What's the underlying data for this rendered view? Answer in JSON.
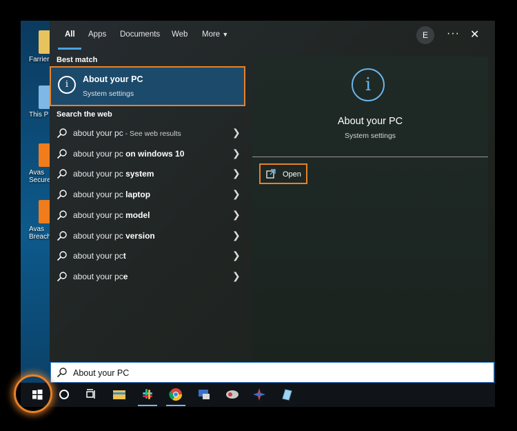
{
  "desktop": {
    "icons": [
      {
        "label": "Farrier P",
        "icon": "folder-icon"
      },
      {
        "label": "This P",
        "icon": "computer-icon"
      },
      {
        "label": "Avas\nSecure",
        "icon": "avast-secureline-icon"
      },
      {
        "label": "Avas\nBreachG",
        "icon": "avast-breachguard-icon"
      }
    ]
  },
  "tabs": {
    "items": [
      "All",
      "Apps",
      "Documents",
      "Web",
      "More"
    ],
    "active": "All",
    "avatar_letter": "E",
    "more_options": "···",
    "close": "✕"
  },
  "best_match": {
    "heading": "Best match",
    "title": "About your PC",
    "subtitle": "System settings",
    "icon": "info-icon"
  },
  "web": {
    "heading": "Search the web",
    "results": [
      {
        "prefix": "about your pc",
        "bold": "",
        "suffix": " - See web results"
      },
      {
        "prefix": "about your pc ",
        "bold": "on windows 10",
        "suffix": ""
      },
      {
        "prefix": "about your pc ",
        "bold": "system",
        "suffix": ""
      },
      {
        "prefix": "about your pc ",
        "bold": "laptop",
        "suffix": ""
      },
      {
        "prefix": "about your pc ",
        "bold": "model",
        "suffix": ""
      },
      {
        "prefix": "about your pc ",
        "bold": "version",
        "suffix": ""
      },
      {
        "prefix": "about your pc",
        "bold": "t",
        "suffix": ""
      },
      {
        "prefix": "about your pc",
        "bold": "e",
        "suffix": ""
      }
    ]
  },
  "detail": {
    "title": "About your PC",
    "subtitle": "System settings",
    "icon": "info-icon",
    "open_label": "Open"
  },
  "search": {
    "value": "About your PC"
  },
  "taskbar": {
    "items": [
      "windows-start-icon",
      "cortana-icon",
      "task-view-icon",
      "file-explorer-icon",
      "slack-icon",
      "chrome-icon",
      "network-app-icon",
      "app-icon",
      "app-icon-2",
      "app-icon-3"
    ]
  },
  "colors": {
    "accent": "#4aa3e0",
    "highlight": "#e8822a",
    "best_match_bg": "#1c4a6b"
  }
}
